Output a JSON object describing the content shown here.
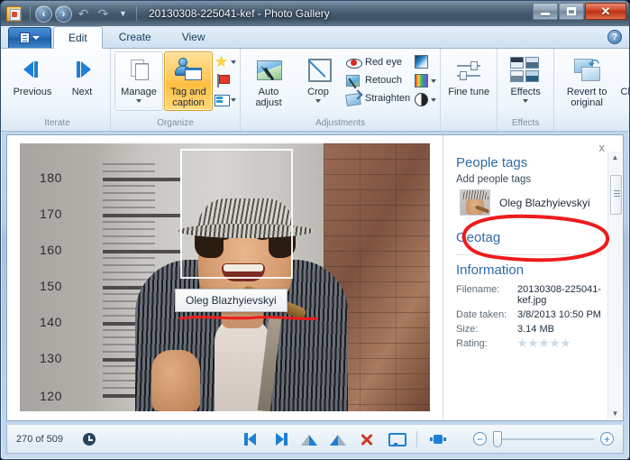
{
  "window": {
    "title": "20130308-225041-kef - Photo Gallery",
    "app_icon": "photo-gallery-icon",
    "controls": {
      "minimize": "Minimize",
      "maximize": "Maximize",
      "close": "Close"
    }
  },
  "quick_access": {
    "back": "Back",
    "forward": "Forward",
    "undo": "Undo",
    "redo": "Redo",
    "customize": "Customize Quick Access Toolbar"
  },
  "tabs": {
    "file_button": "File",
    "items": [
      {
        "label": "Edit",
        "active": true
      },
      {
        "label": "Create",
        "active": false
      },
      {
        "label": "View",
        "active": false
      }
    ],
    "help": "?"
  },
  "ribbon": {
    "groups": [
      {
        "label": "Iterate",
        "buttons": [
          {
            "label": "Previous",
            "icon": "previous-icon"
          },
          {
            "label": "Next",
            "icon": "next-icon"
          }
        ]
      },
      {
        "label": "Organize",
        "buttons": [
          {
            "label": "Manage",
            "icon": "manage-icon",
            "has_caret": true
          },
          {
            "label": "Tag and caption",
            "icon": "tag-and-caption-icon",
            "has_caret": true,
            "selected": true
          }
        ],
        "small_buttons": [
          {
            "label": "Rating",
            "icon": "star-icon",
            "has_caret": true
          },
          {
            "label": "Flag",
            "icon": "flag-icon",
            "has_caret": false
          },
          {
            "label": "Caption",
            "icon": "caption-icon",
            "has_caret": true
          }
        ]
      },
      {
        "label": "Adjustments",
        "buttons": [
          {
            "label": "Auto adjust",
            "icon": "auto-adjust-icon",
            "has_caret": true
          },
          {
            "label": "Crop",
            "icon": "crop-icon",
            "has_caret": true
          }
        ],
        "text_buttons": [
          {
            "label": "Red eye",
            "icon": "red-eye-icon"
          },
          {
            "label": "Retouch",
            "icon": "retouch-icon"
          },
          {
            "label": "Straighten",
            "icon": "straighten-icon"
          }
        ],
        "small_buttons": [
          {
            "label": "Exposure",
            "icon": "exposure-icon",
            "has_caret": false
          },
          {
            "label": "Color",
            "icon": "color-icon",
            "has_caret": true
          },
          {
            "label": "Contrast",
            "icon": "contrast-icon",
            "has_caret": true
          }
        ]
      },
      {
        "label": "",
        "buttons": [
          {
            "label": "Fine tune",
            "icon": "fine-tune-icon",
            "has_caret": false
          }
        ]
      },
      {
        "label": "Effects",
        "buttons": [
          {
            "label": "Effects",
            "icon": "effects-icon",
            "has_caret": true
          },
          {
            "label": "Revert to original",
            "icon": "revert-icon",
            "has_caret": true
          },
          {
            "label": "Close file",
            "icon": "close-file-icon",
            "has_caret": false
          }
        ]
      }
    ]
  },
  "photo": {
    "face_tag_tooltip": "Oleg Blazhyievskyi",
    "ruler_labels": [
      "180",
      "170",
      "160",
      "150",
      "140",
      "130",
      "120"
    ],
    "annotation": "red-hand-drawn-underline"
  },
  "side_panel": {
    "close_label": "x",
    "people_tags": {
      "title": "People tags",
      "add_prompt": "Add people tags",
      "tags": [
        {
          "name": "Oleg Blazhyievskyi",
          "thumbnail": "person-thumbnail"
        }
      ]
    },
    "geotag": {
      "title": "Geotag"
    },
    "information": {
      "title": "Information",
      "rows": [
        {
          "key": "Filename:",
          "value": "20130308-225041-kef.jpg"
        },
        {
          "key": "Date taken:",
          "value": "3/8/2013  10:50 PM"
        },
        {
          "key": "Size:",
          "value": "3.14 MB"
        },
        {
          "key": "Rating:",
          "value": ""
        }
      ],
      "rating_stars": 5,
      "rating_filled": 0
    },
    "annotation": "red-hand-drawn-ellipse"
  },
  "status_bar": {
    "count": "270 of 509",
    "clock_icon": "clock-icon",
    "buttons": [
      {
        "icon": "previous-photo-icon",
        "label": "Previous"
      },
      {
        "icon": "next-photo-icon",
        "label": "Next"
      },
      {
        "icon": "rotate-left-icon",
        "label": "Rotate counterclockwise"
      },
      {
        "icon": "rotate-right-icon",
        "label": "Rotate clockwise"
      },
      {
        "icon": "delete-icon",
        "label": "Delete"
      },
      {
        "icon": "slideshow-icon",
        "label": "Play slide show"
      }
    ],
    "fit_icon": "fit-to-window-icon",
    "zoom_out": "−",
    "zoom_in": "+",
    "zoom_value": 0
  },
  "colors": {
    "accent": "#1f7fd4",
    "selected": "#ffc85c",
    "section_heading": "#2f6ba8",
    "annotation_red": "#ee1c1c",
    "close_red": "#cf4425"
  }
}
